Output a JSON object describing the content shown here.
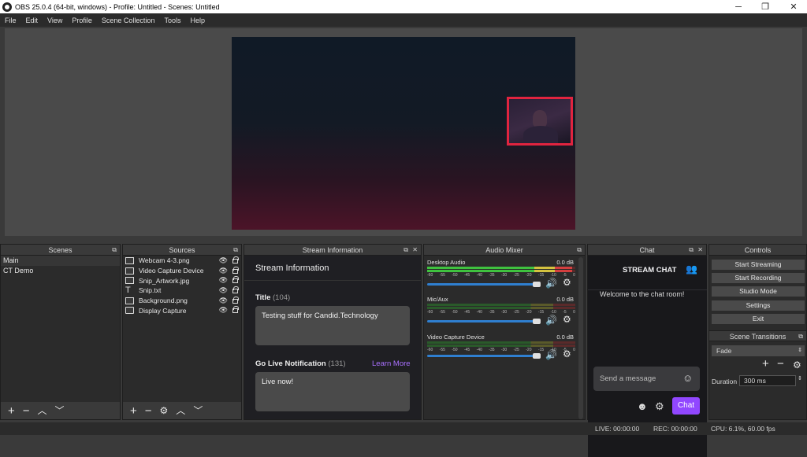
{
  "window": {
    "title": "OBS 25.0.4 (64-bit, windows) - Profile: Untitled - Scenes: Untitled"
  },
  "menu": [
    "File",
    "Edit",
    "View",
    "Profile",
    "Scene Collection",
    "Tools",
    "Help"
  ],
  "scenes": {
    "title": "Scenes",
    "items": [
      "Main",
      "CT Demo"
    ],
    "selected": "Main"
  },
  "sources": {
    "title": "Sources",
    "items": [
      {
        "name": "Webcam 4-3.png",
        "icon": "image-icon"
      },
      {
        "name": "Video Capture Device",
        "icon": "camera-icon"
      },
      {
        "name": "Snip_Artwork.jpg",
        "icon": "image-icon"
      },
      {
        "name": "Snip.txt",
        "icon": "text-icon"
      },
      {
        "name": "Background.png",
        "icon": "image-icon"
      },
      {
        "name": "Display Capture",
        "icon": "monitor-icon"
      }
    ]
  },
  "stream_info": {
    "dock_title": "Stream Information",
    "heading": "Stream Information",
    "title_label": "Title",
    "title_count": "(104)",
    "title_value": "Testing stuff for Candid.Technology",
    "notification_label": "Go Live Notification",
    "notification_count": "(131)",
    "learn_more": "Learn More",
    "notification_value": "Live now!"
  },
  "audio_mixer": {
    "title": "Audio Mixer",
    "tick_labels": [
      "-60",
      "-55",
      "-50",
      "-45",
      "-40",
      "-35",
      "-30",
      "-25",
      "-20",
      "-15",
      "-10",
      "-5",
      "0"
    ],
    "channels": [
      {
        "name": "Desktop Audio",
        "db": "0.0 dB",
        "level": 0.98,
        "volume": 1.0
      },
      {
        "name": "Mic/Aux",
        "db": "0.0 dB",
        "level": 0.0,
        "volume": 1.0
      },
      {
        "name": "Video Capture Device",
        "db": "0.0 dB",
        "level": 0.0,
        "volume": 1.0
      }
    ]
  },
  "chat": {
    "dock_title": "Chat",
    "header": "STREAM CHAT",
    "welcome": "Welcome to the chat room!",
    "placeholder": "Send a message",
    "send_label": "Chat"
  },
  "controls": {
    "title": "Controls",
    "buttons": [
      "Start Streaming",
      "Start Recording",
      "Studio Mode",
      "Settings",
      "Exit"
    ]
  },
  "transitions": {
    "title": "Scene Transitions",
    "selected": "Fade",
    "duration_label": "Duration",
    "duration_value": "300 ms"
  },
  "status": {
    "live": "LIVE: 00:00:00",
    "rec": "REC: 00:00:00",
    "cpu": "CPU: 6.1%, 60.00 fps"
  },
  "colors": {
    "accent_chat": "#9147ff",
    "learn_more": "#a970ff",
    "webcam_border": "#e0243f"
  }
}
